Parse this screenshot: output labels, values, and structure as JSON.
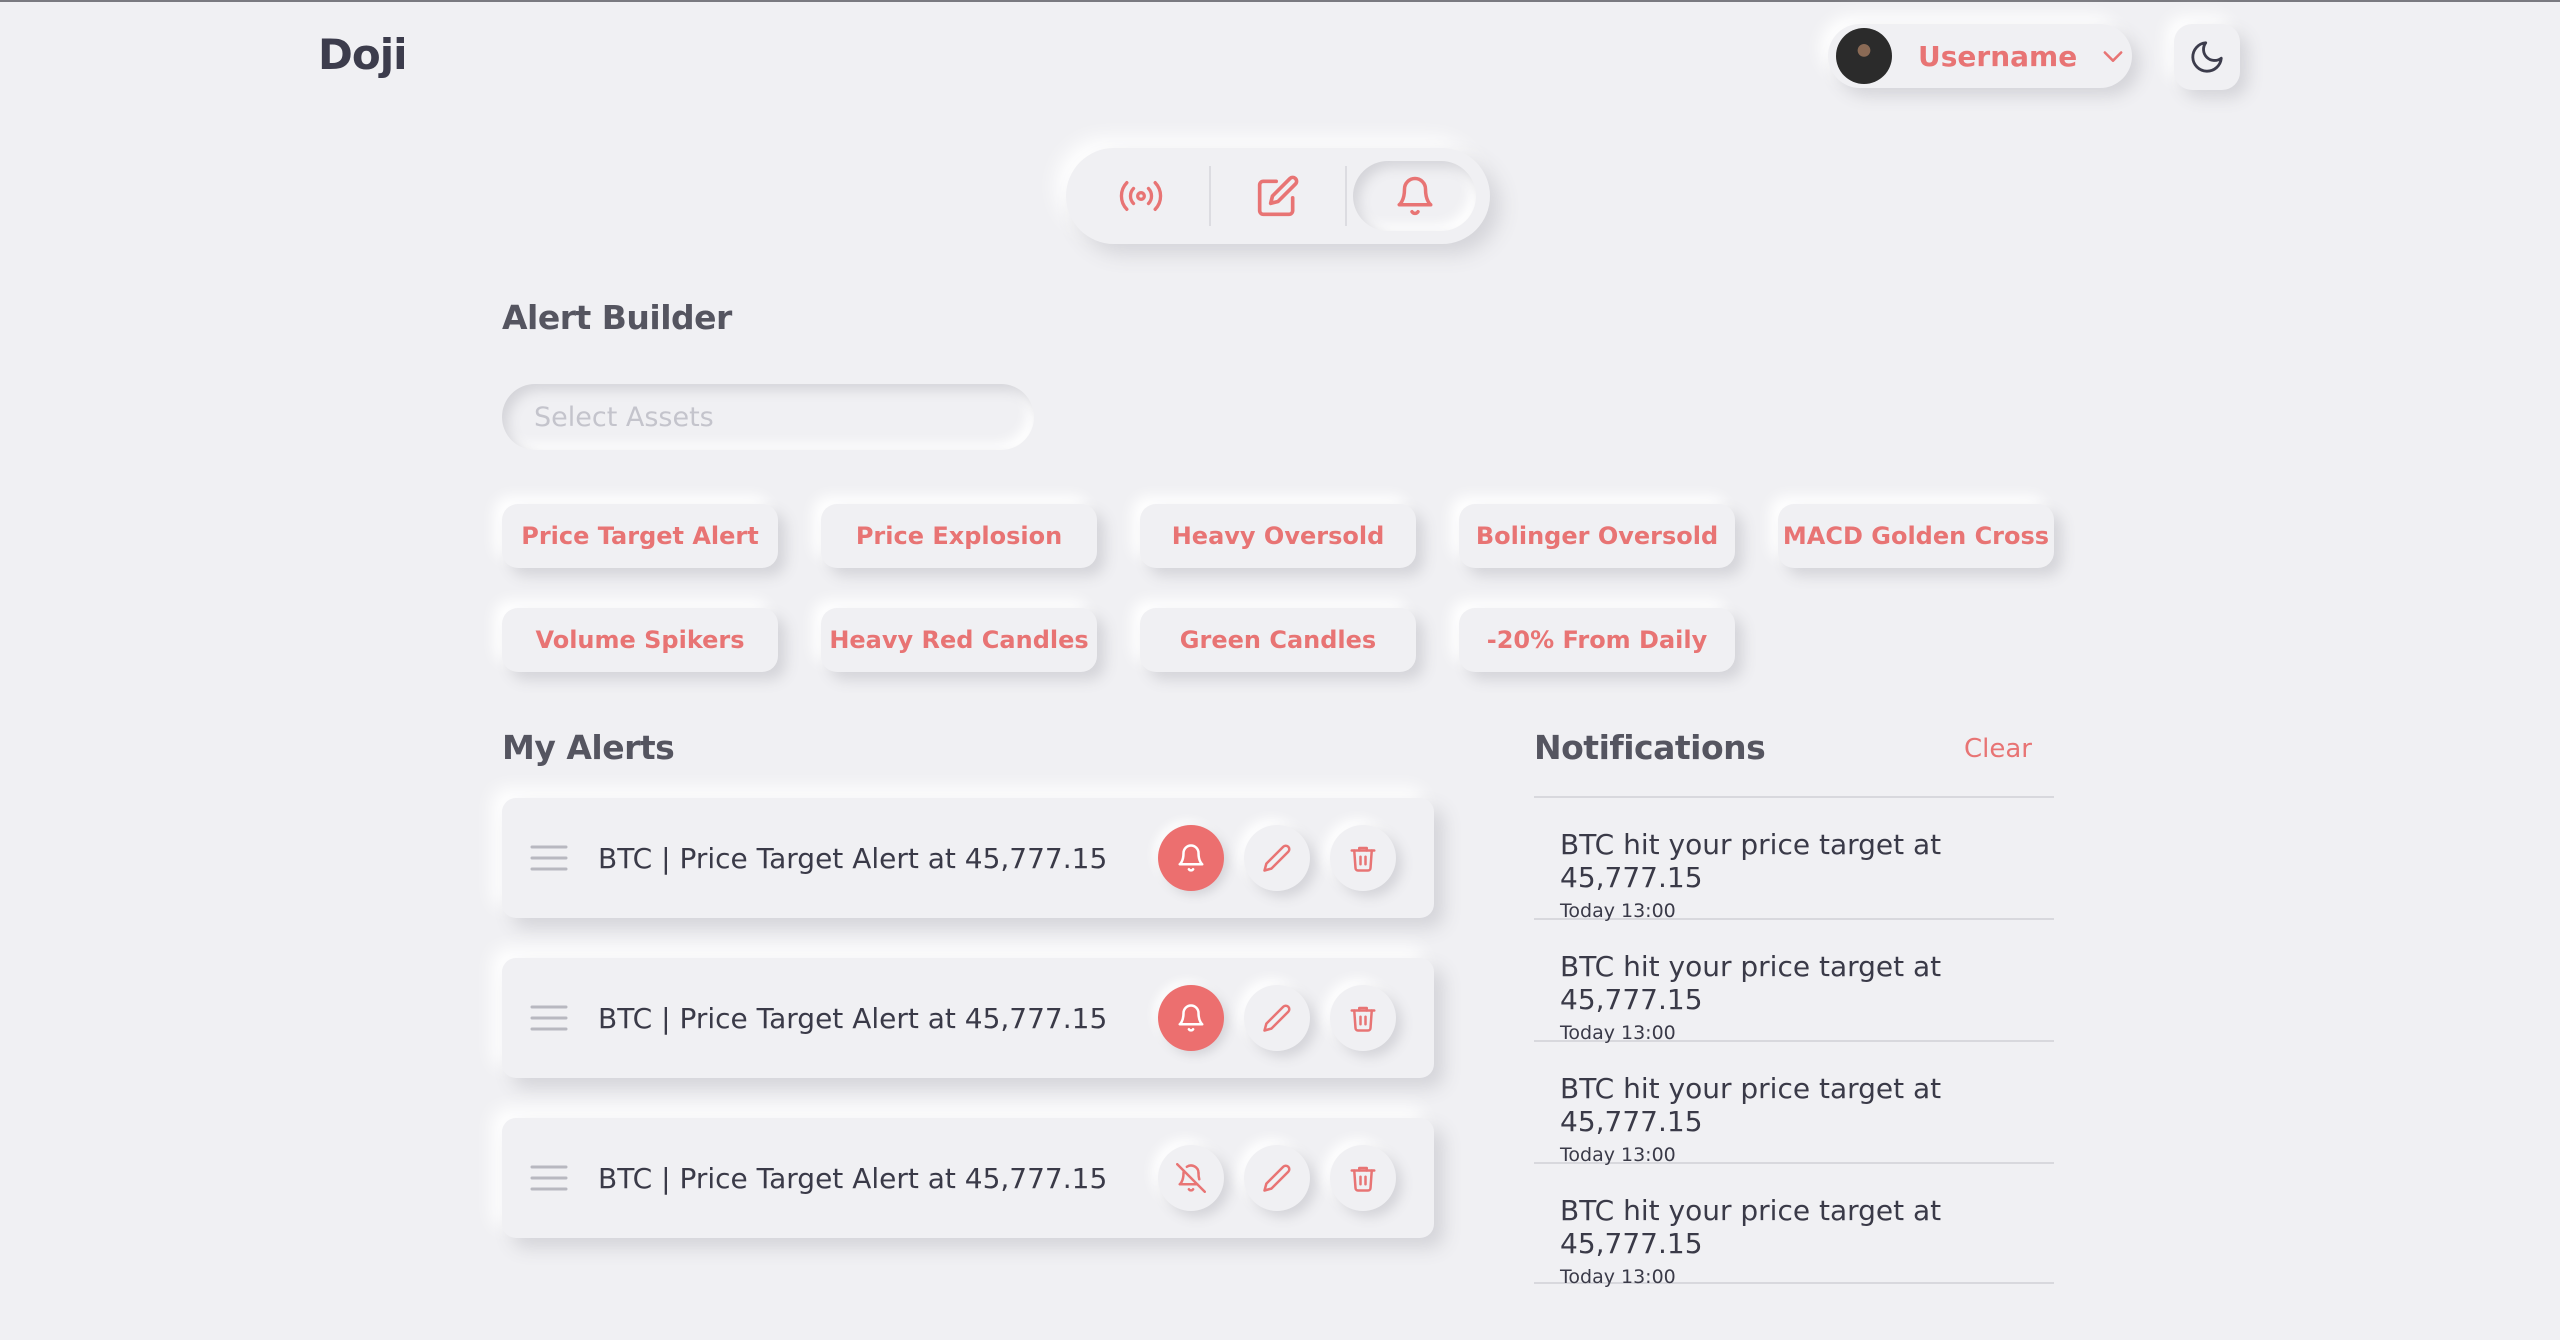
{
  "app": {
    "title": "Doji"
  },
  "header": {
    "username": "Username"
  },
  "nav": {
    "items": [
      "broadcast-icon",
      "edit-icon",
      "bell-icon"
    ],
    "active": 2
  },
  "alert_builder": {
    "title": "Alert Builder",
    "search_placeholder": "Select Assets",
    "templates": [
      "Price Target Alert",
      "Price Explosion",
      "Heavy Oversold",
      "Bolinger Oversold",
      "MACD Golden Cross",
      "Volume Spikers",
      "Heavy Red Candles",
      "Green Candles",
      "-20% From Daily"
    ]
  },
  "my_alerts": {
    "title": "My Alerts",
    "items": [
      {
        "text": "BTC | Price Target Alert at 45,777.15",
        "enabled": true
      },
      {
        "text": "BTC | Price Target Alert at 45,777.15",
        "enabled": true
      },
      {
        "text": "BTC | Price Target Alert at 45,777.15",
        "enabled": false
      }
    ]
  },
  "notifications": {
    "title": "Notifications",
    "clear_label": "Clear",
    "items": [
      {
        "text": "BTC hit your price target at 45,777.15",
        "time": "Today 13:00"
      },
      {
        "text": "BTC hit your price target at 45,777.15",
        "time": "Today 13:00"
      },
      {
        "text": "BTC hit your price target at 45,777.15",
        "time": "Today 13:00"
      },
      {
        "text": "BTC hit your price target at 45,777.15",
        "time": "Today 13:00"
      }
    ]
  },
  "colors": {
    "accent": "#e87474",
    "background": "#f0f0f3",
    "text": "#3a3a48"
  }
}
